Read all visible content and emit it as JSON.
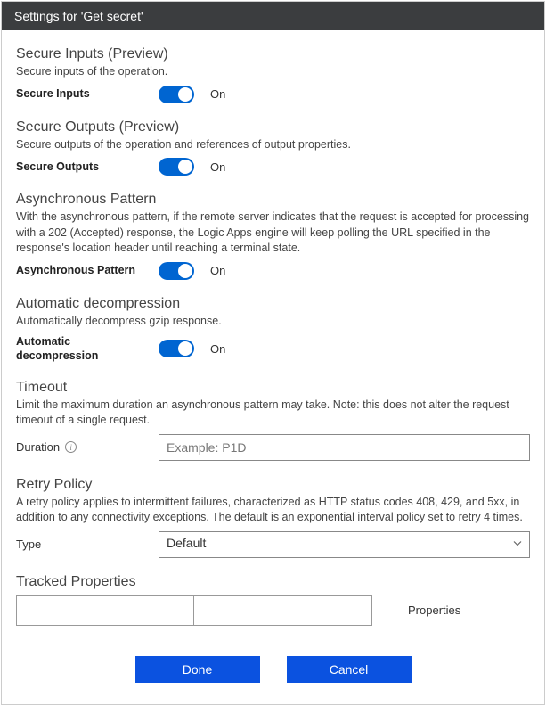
{
  "header": {
    "title": "Settings for 'Get secret'"
  },
  "secureInputs": {
    "title": "Secure Inputs (Preview)",
    "desc": "Secure inputs of the operation.",
    "label": "Secure Inputs",
    "state": "On"
  },
  "secureOutputs": {
    "title": "Secure Outputs (Preview)",
    "desc": "Secure outputs of the operation and references of output properties.",
    "label": "Secure Outputs",
    "state": "On"
  },
  "asyncPattern": {
    "title": "Asynchronous Pattern",
    "desc": "With the asynchronous pattern, if the remote server indicates that the request is accepted for processing with a 202 (Accepted) response, the Logic Apps engine will keep polling the URL specified in the response's location header until reaching a terminal state.",
    "label": "Asynchronous Pattern",
    "state": "On"
  },
  "autoDecompress": {
    "title": "Automatic decompression",
    "desc": "Automatically decompress gzip response.",
    "label": "Automatic decompression",
    "state": "On"
  },
  "timeout": {
    "title": "Timeout",
    "desc": "Limit the maximum duration an asynchronous pattern may take. Note: this does not alter the request timeout of a single request.",
    "label": "Duration",
    "placeholder": "Example: P1D"
  },
  "retry": {
    "title": "Retry Policy",
    "desc": "A retry policy applies to intermittent failures, characterized as HTTP status codes 408, 429, and 5xx, in addition to any connectivity exceptions. The default is an exponential interval policy set to retry 4 times.",
    "label": "Type",
    "selected": "Default"
  },
  "tracked": {
    "title": "Tracked Properties",
    "colLabel": "Properties"
  },
  "buttons": {
    "done": "Done",
    "cancel": "Cancel"
  }
}
